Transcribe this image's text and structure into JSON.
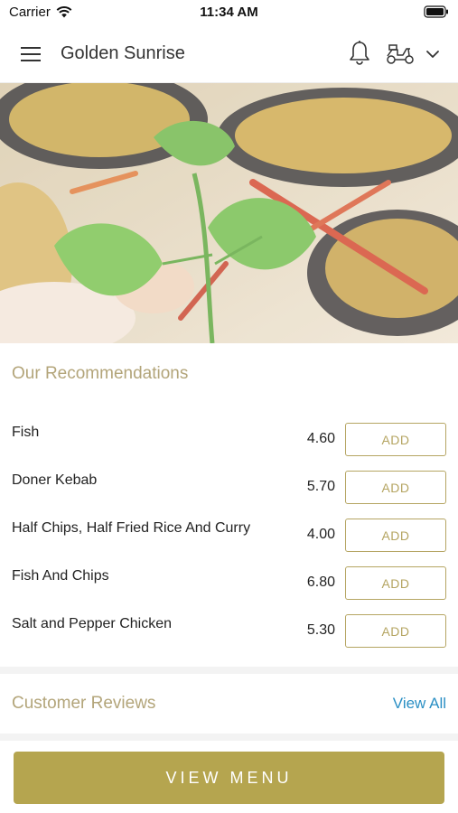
{
  "status_bar": {
    "carrier": "Carrier",
    "time": "11:34 AM"
  },
  "header": {
    "title": "Golden Sunrise",
    "icons": [
      "menu-icon",
      "bell-icon",
      "scooter-icon",
      "chevron-down-icon"
    ]
  },
  "hero": {
    "image": "food-photo"
  },
  "recommendations": {
    "title": "Our Recommendations",
    "items": [
      {
        "name": "Fish",
        "price": "4.60",
        "button": "ADD"
      },
      {
        "name": "Doner Kebab",
        "price": "5.70",
        "button": "ADD"
      },
      {
        "name": "Half Chips, Half Fried Rice And Curry",
        "price": "4.00",
        "button": "ADD"
      },
      {
        "name": "Fish And Chips",
        "price": "6.80",
        "button": "ADD"
      },
      {
        "name": "Salt and Pepper Chicken",
        "price": "5.30",
        "button": "ADD"
      }
    ]
  },
  "reviews": {
    "title": "Customer Reviews",
    "link": "View All"
  },
  "footer": {
    "button": "VIEW MENU"
  },
  "colors": {
    "accent": "#b5a54f",
    "section_title": "#b3a57a",
    "link": "#2a8fc4"
  }
}
